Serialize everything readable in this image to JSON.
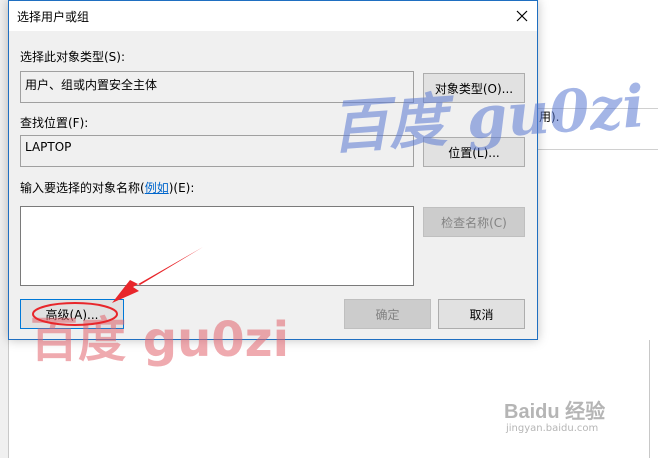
{
  "background": {
    "partial_text": "用)."
  },
  "dialog": {
    "title": "选择用户或组",
    "object_type_label": "选择此对象类型(S):",
    "object_type_value": "用户、组或内置安全主体",
    "object_types_button": "对象类型(O)...",
    "location_label": "查找位置(F):",
    "location_value": "LAPTOP",
    "locations_button": "位置(L)...",
    "names_label_prefix": "输入要选择的对象名称(",
    "names_label_link": "例如",
    "names_label_suffix": ")(E):",
    "names_value": "",
    "check_names_button": "检查名称(C)",
    "advanced_button": "高级(A)...",
    "ok_button": "确定",
    "cancel_button": "取消"
  },
  "watermarks": {
    "handwritten": "百度 gu0zi",
    "red_text": "百度  gu0zi",
    "baidu_logo": "Baidu 经验",
    "baidu_url": "jingyan.baidu.com"
  },
  "colors": {
    "annotation_red": "#e8262b",
    "dialog_border": "#1f6fc1",
    "link": "#0066cc"
  }
}
